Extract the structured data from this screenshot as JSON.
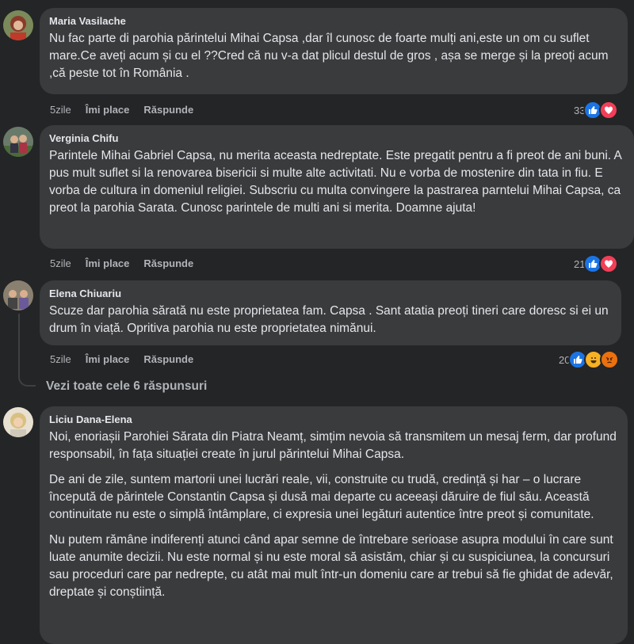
{
  "comments": [
    {
      "author": "Maria Vasilache",
      "text": "Nu fac parte di parohia părintelui Mihai Capsa ,dar îl cunosc de foarte mulți ani,este un om cu suflet mare.Ce aveți acum și cu el ??Cred că nu v-a dat plicul destul de gros , așa se merge și la preoți acum ,că peste tot în România .",
      "time": "5zile",
      "like_label": "Îmi place",
      "reply_label": "Răspunde",
      "reaction_count": "33"
    },
    {
      "author": "Verginia Chifu",
      "text": "Parintele Mihai Gabriel Capsa, nu merita aceasta nedreptate. Este pregatit pentru a fi preot de ani buni. A pus mult suflet si la renovarea bisericii si multe alte activitati. Nu e vorba de mostenire din tata in fiu. E vorba de cultura in domeniul religiei. Subscriu cu multa convingere la pastrarea parntelui Mihai Capsa, ca preot la parohia Sarata. Cunosc parintele de multi ani si merita. Doamne ajuta!",
      "time": "5zile",
      "like_label": "Îmi place",
      "reply_label": "Răspunde",
      "reaction_count": "21"
    },
    {
      "author": "Elena Chiuariu",
      "text": "Scuze dar parohia sărată nu este proprietatea fam. Capsa . Sant atatia preoți tineri care doresc si ei un drum în viață. Opritiva parohia nu este proprietatea nimănui.",
      "time": "5zile",
      "like_label": "Îmi place",
      "reply_label": "Răspunde",
      "reaction_count": "20"
    },
    {
      "author": "Liciu Dana-Elena",
      "paragraphs": [
        "Noi, enoriașii Parohiei Sărata din Piatra Neamț, simțim nevoia să transmitem un mesaj ferm, dar profund responsabil, în fața situației create în jurul părintelui Mihai Capsa.",
        "De ani de zile, suntem martorii unei lucrări reale, vii, construite cu trudă, credință și har – o lucrare începută de părintele Constantin Capsa și dusă mai departe cu aceeași dăruire de fiul său. Această continuitate nu este o simplă întâmplare, ci expresia unei legături autentice între preot și comunitate.",
        "Nu putem rămâne indiferenți atunci când apar semne de întrebare serioase asupra modului în care sunt luate anumite decizii. Nu este normal și nu este moral să asistăm, chiar și cu suspiciunea, la concursuri sau proceduri care par nedrepte, cu atât mai mult într-un domeniu care ar trebui să fie ghidat de adevăr, dreptate și conștiință."
      ]
    }
  ],
  "view_replies": "Vezi toate cele 6 răspunsuri",
  "colors": {
    "background": "#242526",
    "bubble": "#3a3b3c",
    "text": "#e4e6eb",
    "muted": "#b0b3b8",
    "like": "#1b74e4",
    "love": "#f33e58"
  },
  "icons": [
    "like-icon",
    "love-icon",
    "haha-icon",
    "angry-icon"
  ]
}
